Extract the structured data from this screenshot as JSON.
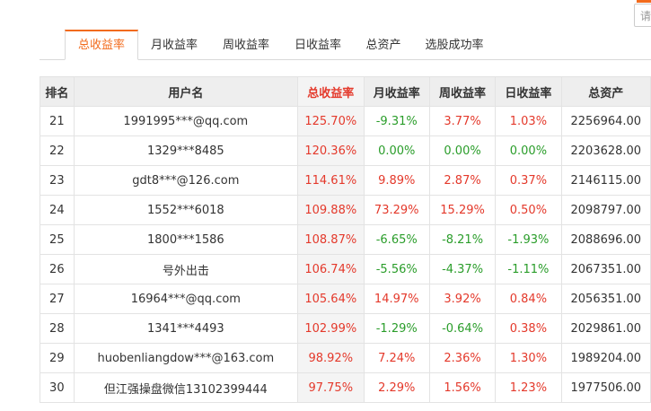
{
  "search": {
    "placeholder": "请"
  },
  "tabs": [
    {
      "label": "总收益率",
      "active": true
    },
    {
      "label": "月收益率",
      "active": false
    },
    {
      "label": "周收益率",
      "active": false
    },
    {
      "label": "日收益率",
      "active": false
    },
    {
      "label": "总资产",
      "active": false
    },
    {
      "label": "选股成功率",
      "active": false
    }
  ],
  "table": {
    "headers": [
      "排名",
      "用户名",
      "总收益率",
      "月收益率",
      "周收益率",
      "日收益率",
      "总资产"
    ],
    "rows": [
      {
        "rank": "21",
        "user": "1991995***@qq.com",
        "total": "125.70%",
        "month": "-9.31%",
        "week": "3.77%",
        "day": "1.03%",
        "assets": "2256964.00"
      },
      {
        "rank": "22",
        "user": "1329***8485",
        "total": "120.36%",
        "month": "0.00%",
        "week": "0.00%",
        "day": "0.00%",
        "assets": "2203628.00"
      },
      {
        "rank": "23",
        "user": "gdt8***@126.com",
        "total": "114.61%",
        "month": "9.89%",
        "week": "2.87%",
        "day": "0.37%",
        "assets": "2146115.00"
      },
      {
        "rank": "24",
        "user": "1552***6018",
        "total": "109.88%",
        "month": "73.29%",
        "week": "15.29%",
        "day": "0.50%",
        "assets": "2098797.00"
      },
      {
        "rank": "25",
        "user": "1800***1586",
        "total": "108.87%",
        "month": "-6.65%",
        "week": "-8.21%",
        "day": "-1.93%",
        "assets": "2088696.00"
      },
      {
        "rank": "26",
        "user": "号外出击",
        "total": "106.74%",
        "month": "-5.56%",
        "week": "-4.37%",
        "day": "-1.11%",
        "assets": "2067351.00"
      },
      {
        "rank": "27",
        "user": "16964***@qq.com",
        "total": "105.64%",
        "month": "14.97%",
        "week": "3.92%",
        "day": "0.84%",
        "assets": "2056351.00"
      },
      {
        "rank": "28",
        "user": "1341***4493",
        "total": "102.99%",
        "month": "-1.29%",
        "week": "-0.64%",
        "day": "0.38%",
        "assets": "2029861.00"
      },
      {
        "rank": "29",
        "user": "huobenliangdow***@163.com",
        "total": "98.92%",
        "month": "7.24%",
        "week": "2.36%",
        "day": "1.30%",
        "assets": "1989204.00"
      },
      {
        "rank": "30",
        "user": "但江强操盘微信13102399444",
        "total": "97.75%",
        "month": "2.29%",
        "week": "1.56%",
        "day": "1.23%",
        "assets": "1977506.00"
      }
    ]
  },
  "colors": {
    "accent": "#f26b1d",
    "positive": "#e4392b",
    "negative": "#2a9d2a"
  }
}
